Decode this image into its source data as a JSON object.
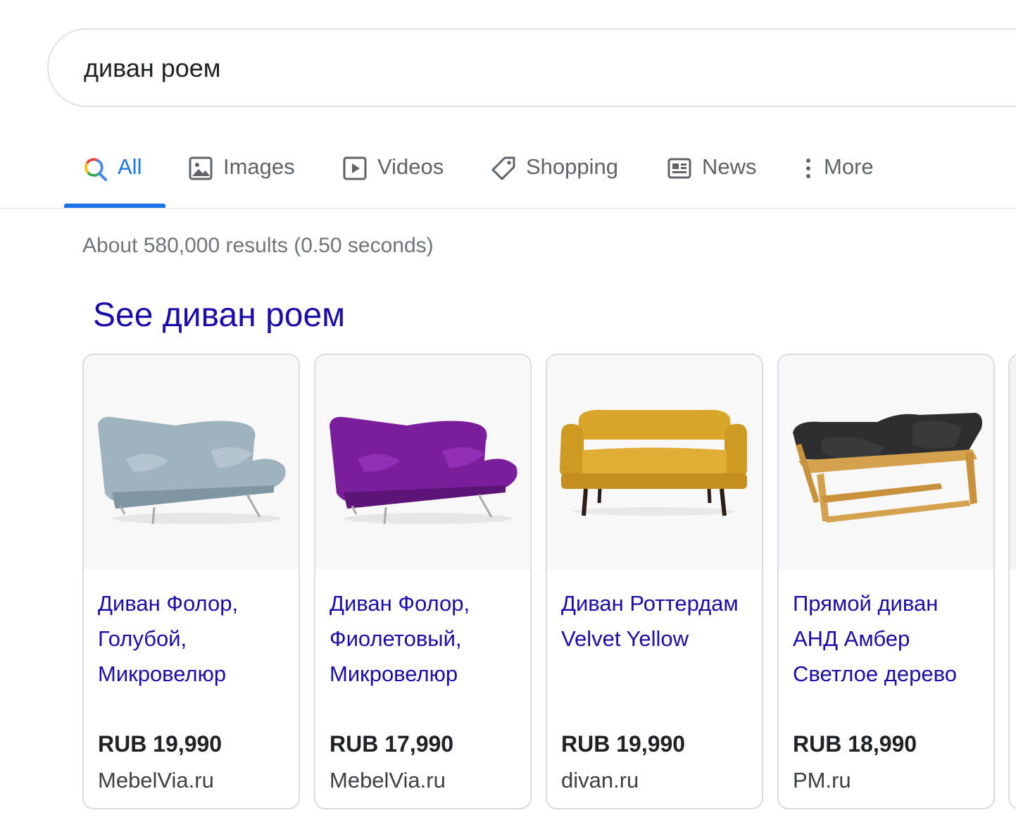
{
  "search": {
    "query": "диван роем"
  },
  "tabs": [
    {
      "label": "All",
      "icon": "search-icon",
      "active": true
    },
    {
      "label": "Images",
      "icon": "image-icon",
      "active": false
    },
    {
      "label": "Videos",
      "icon": "video-icon",
      "active": false
    },
    {
      "label": "Shopping",
      "icon": "tag-icon",
      "active": false
    },
    {
      "label": "News",
      "icon": "news-icon",
      "active": false
    },
    {
      "label": "More",
      "icon": "more-vert-icon",
      "active": false
    }
  ],
  "result_stats": "About 580,000 results (0.50 seconds)",
  "shopping": {
    "heading": "See диван роем",
    "products": [
      {
        "title": "Диван Фолор, Голубой, Микровелюр",
        "price": "RUB 19,990",
        "merchant": "MebelVia.ru",
        "color": "#9fb3bf"
      },
      {
        "title": "Диван Фолор, Фиолетовый, Микровелюр",
        "price": "RUB 17,990",
        "merchant": "MebelVia.ru",
        "color": "#7a1e9c"
      },
      {
        "title": "Диван Роттердам Velvet Yellow",
        "price": "RUB 19,990",
        "merchant": "divan.ru",
        "color": "#d9a52b"
      },
      {
        "title": "Прямой диван АНД Амбер Светлое дерево",
        "price": "RUB 18,990",
        "merchant": "PM.ru",
        "color": "#2e2e30"
      }
    ]
  },
  "colors": {
    "link": "#1a0dab",
    "accent": "#1a73e8",
    "muted": "#5f6368"
  }
}
